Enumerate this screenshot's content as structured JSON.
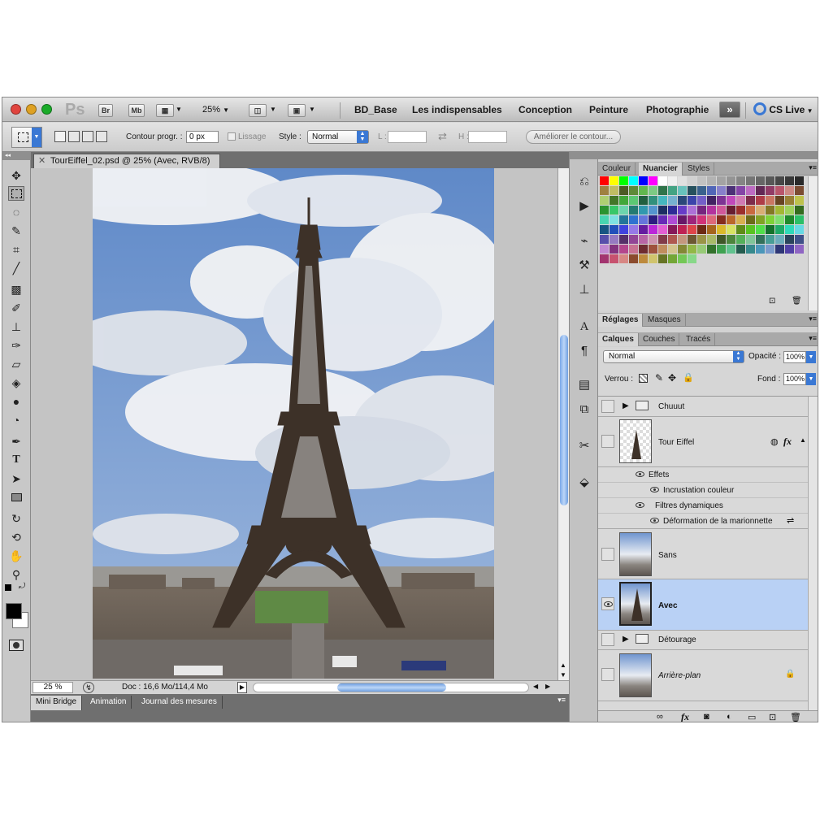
{
  "app": {
    "logo": "Ps",
    "br_label": "Br",
    "mb_label": "Mb",
    "zoom": "25%",
    "workspaces": [
      "BD_Base",
      "Les indispensables",
      "Conception",
      "Peinture",
      "Photographie"
    ],
    "cs_live": "CS Live"
  },
  "options": {
    "contour_label": "Contour progr. :",
    "contour_value": "0 px",
    "lissage_label": "Lissage",
    "style_label": "Style :",
    "style_value": "Normal",
    "l_label": "L :",
    "h_label": "H :",
    "ameliorer": "Améliorer le contour..."
  },
  "document": {
    "tab_title": "TourEiffel_02.psd @ 25% (Avec, RVB/8)",
    "zoom_status": "25 %",
    "doc_size": "Doc : 16,6 Mo/114,4 Mo"
  },
  "bottom_tabs": [
    "Mini Bridge",
    "Animation",
    "Journal des mesures"
  ],
  "swatch_panel": {
    "tabs": [
      "Couleur",
      "Nuancier",
      "Styles"
    ],
    "active": 1
  },
  "adjust_panel": {
    "tabs": [
      "Réglages",
      "Masques"
    ],
    "active": 0
  },
  "layers_panel": {
    "tabs": [
      "Calques",
      "Couches",
      "Tracés"
    ],
    "blend_mode": "Normal",
    "opacity_label": "Opacité :",
    "opacity_value": "100%",
    "lock_label": "Verrou :",
    "fill_label": "Fond :",
    "fill_value": "100%",
    "group_chuuut": "Chuuut",
    "tour_eiffel": "Tour Eiffel",
    "effets": "Effets",
    "incrustation": "Incrustation couleur",
    "filtres": "Filtres dynamiques",
    "deformation": "Déformation de la marionnette",
    "sans": "Sans",
    "avec": "Avec",
    "detourage": "Détourage",
    "arriere_plan": "Arrière-plan",
    "fx": "fx"
  },
  "colors": {
    "accent": "#3a78d4",
    "selected_layer": "#b9d1f5",
    "traffic_red": "#e0443e",
    "traffic_yellow": "#dea123",
    "traffic_green": "#1aab29",
    "sky": "#7ea3d6"
  }
}
